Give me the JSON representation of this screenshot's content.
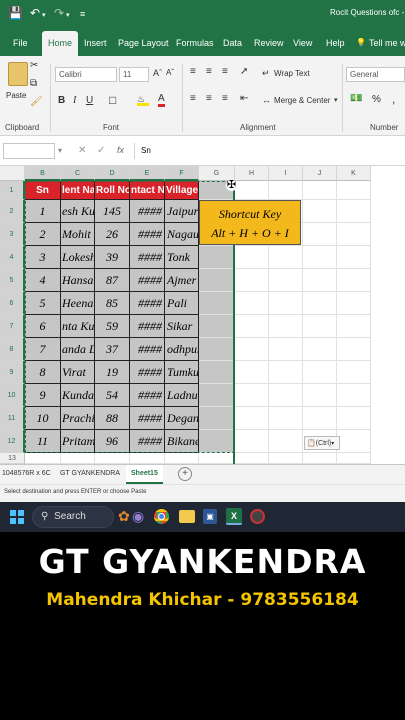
{
  "titlebar": {
    "title": "Rocit Questions ofc  -  Excel"
  },
  "menu": {
    "items": [
      "File",
      "Home",
      "Insert",
      "Page Layout",
      "Formulas",
      "Data",
      "Review",
      "View",
      "Help",
      "Tell me w"
    ],
    "active": "Home"
  },
  "ribbon": {
    "paste": "Paste",
    "font_name": "Calibri",
    "font_size": "11",
    "wrap_text": "Wrap Text",
    "merge_center": "Merge & Center",
    "number_format": "General",
    "percent": "%",
    "comma": ",",
    "bold": "B",
    "italic": "I",
    "underline": "U",
    "font_grow": "Aˆ",
    "font_shrink": "Aˇ",
    "font_color": "A",
    "groups": [
      "Clipboard",
      "Font",
      "Alignment",
      "Number"
    ]
  },
  "formula_bar": {
    "name_box": "",
    "fx": "fx",
    "content": "Sn"
  },
  "columns": [
    "B",
    "C",
    "D",
    "E",
    "F",
    "G",
    "H",
    "I",
    "J",
    "K"
  ],
  "rows": [
    "1",
    "2",
    "3",
    "4",
    "5",
    "6",
    "7",
    "8",
    "9",
    "10",
    "11",
    "12",
    "13"
  ],
  "table": {
    "headers": [
      "Sn",
      "lent Na",
      "Roll No",
      "ntact N",
      "Village"
    ],
    "rows": [
      [
        "1",
        "esh Kun",
        "145",
        "####",
        "Jaipur"
      ],
      [
        "2",
        "Mohit",
        "26",
        "####",
        "Nagaur"
      ],
      [
        "3",
        "Lokesh",
        "39",
        "####",
        "Tonk"
      ],
      [
        "4",
        "Hansa",
        "87",
        "####",
        "Ajmer"
      ],
      [
        "5",
        "Heena",
        "85",
        "####",
        "Pali"
      ],
      [
        "6",
        "nta Kur",
        "59",
        "####",
        "Sikar"
      ],
      [
        "7",
        "anda D",
        "37",
        "####",
        "odhpur"
      ],
      [
        "8",
        "Virat",
        "19",
        "####",
        "Tumkur"
      ],
      [
        "9",
        "Kundan",
        "54",
        "####",
        "Ladnu"
      ],
      [
        "10",
        "Prachi",
        "88",
        "####",
        "Degana"
      ],
      [
        "11",
        "Pritam",
        "96",
        "####",
        "Bikaner"
      ]
    ]
  },
  "shortcut_box": {
    "title": "Shortcut Key",
    "keys": "Alt + H + O + I"
  },
  "paste_options": {
    "label": "(Ctrl)"
  },
  "sheet_tabs": {
    "name_box": "1048576R x 6C",
    "tabs": [
      "GT GYANKENDRA",
      "Sheet15"
    ],
    "active": "Sheet15",
    "add": "+"
  },
  "status": {
    "message": "Select destination and press ENTER or choose Paste"
  },
  "taskbar": {
    "search": "Search"
  },
  "banner": {
    "title": "GT  GYANKENDRA",
    "subtitle": "Mahendra Khichar - 9783556184"
  },
  "colors": {
    "excel_green": "#217346",
    "header_red": "#d9232a",
    "shortcut_yellow": "#f2b81c",
    "subtitle_yellow": "#f5c400",
    "selection_gray": "#c6c6c6"
  }
}
